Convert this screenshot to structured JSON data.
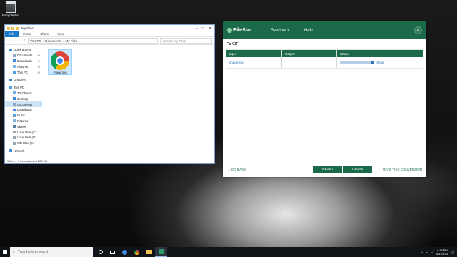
{
  "desktop": {
    "recycle_bin_label": "Recycle Bin"
  },
  "explorer": {
    "title": "My Files",
    "ribbon_tabs": [
      "File",
      "Home",
      "Share",
      "View"
    ],
    "breadcrumb": [
      "This PC",
      "Documents",
      "My Files"
    ],
    "search_placeholder": "Search My Files",
    "nav": {
      "quick_access": "Quick access",
      "quick_items": [
        "Documents",
        "Downloads",
        "Pictures",
        "This PC"
      ],
      "onedrive": "OneDrive",
      "this_pc": "This PC",
      "pc_items": [
        "3D Objects",
        "Desktop",
        "Documents",
        "Downloads",
        "Music",
        "Pictures",
        "Videos",
        "Local Disk (C:)",
        "Local Disk (D:)",
        "WD Blue (E:)"
      ],
      "network": "Network"
    },
    "file": {
      "name": "image.svg"
    },
    "status": {
      "count": "1 item",
      "selected": "1 item selected  223 KB"
    }
  },
  "filestar": {
    "brand": "FileStar",
    "menu": {
      "feedback": "Feedback",
      "help": "Help"
    },
    "close_glyph": "✕",
    "heading": "To GIF",
    "columns": {
      "input": "Input",
      "output": "Output",
      "status": "Status"
    },
    "row": {
      "input": "image.svg",
      "output": "",
      "progress": 0.96,
      "abort": "Abort"
    },
    "footer": {
      "go_back": "GO BACK",
      "reset": "RESET",
      "close": "CLOSE",
      "rate": "RATE THIS CONVERSION"
    },
    "accent": "#1b6a49"
  },
  "taskbar": {
    "search_placeholder": "Type here to search",
    "time": "4:13 PM",
    "date": "8/31/2018"
  }
}
